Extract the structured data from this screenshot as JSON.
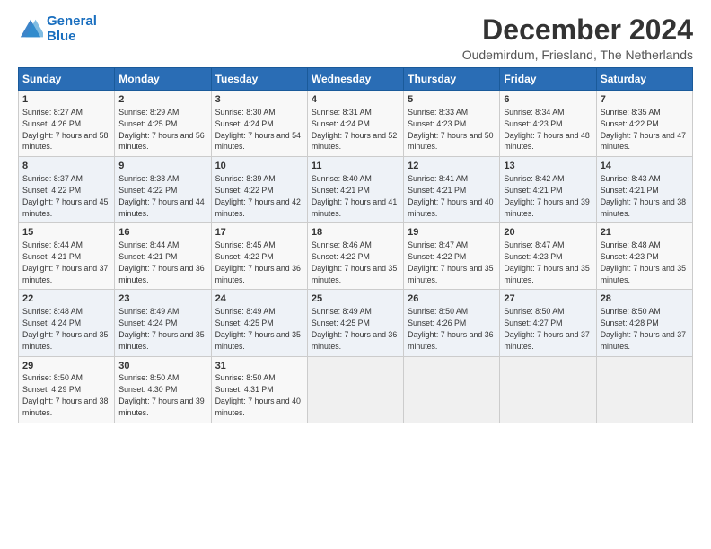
{
  "logo": {
    "line1": "General",
    "line2": "Blue"
  },
  "title": "December 2024",
  "subtitle": "Oudemirdum, Friesland, The Netherlands",
  "days_of_week": [
    "Sunday",
    "Monday",
    "Tuesday",
    "Wednesday",
    "Thursday",
    "Friday",
    "Saturday"
  ],
  "weeks": [
    [
      {
        "day": "1",
        "sunrise": "8:27 AM",
        "sunset": "4:26 PM",
        "daylight": "7 hours and 58 minutes."
      },
      {
        "day": "2",
        "sunrise": "8:29 AM",
        "sunset": "4:25 PM",
        "daylight": "7 hours and 56 minutes."
      },
      {
        "day": "3",
        "sunrise": "8:30 AM",
        "sunset": "4:24 PM",
        "daylight": "7 hours and 54 minutes."
      },
      {
        "day": "4",
        "sunrise": "8:31 AM",
        "sunset": "4:24 PM",
        "daylight": "7 hours and 52 minutes."
      },
      {
        "day": "5",
        "sunrise": "8:33 AM",
        "sunset": "4:23 PM",
        "daylight": "7 hours and 50 minutes."
      },
      {
        "day": "6",
        "sunrise": "8:34 AM",
        "sunset": "4:23 PM",
        "daylight": "7 hours and 48 minutes."
      },
      {
        "day": "7",
        "sunrise": "8:35 AM",
        "sunset": "4:22 PM",
        "daylight": "7 hours and 47 minutes."
      }
    ],
    [
      {
        "day": "8",
        "sunrise": "8:37 AM",
        "sunset": "4:22 PM",
        "daylight": "7 hours and 45 minutes."
      },
      {
        "day": "9",
        "sunrise": "8:38 AM",
        "sunset": "4:22 PM",
        "daylight": "7 hours and 44 minutes."
      },
      {
        "day": "10",
        "sunrise": "8:39 AM",
        "sunset": "4:22 PM",
        "daylight": "7 hours and 42 minutes."
      },
      {
        "day": "11",
        "sunrise": "8:40 AM",
        "sunset": "4:21 PM",
        "daylight": "7 hours and 41 minutes."
      },
      {
        "day": "12",
        "sunrise": "8:41 AM",
        "sunset": "4:21 PM",
        "daylight": "7 hours and 40 minutes."
      },
      {
        "day": "13",
        "sunrise": "8:42 AM",
        "sunset": "4:21 PM",
        "daylight": "7 hours and 39 minutes."
      },
      {
        "day": "14",
        "sunrise": "8:43 AM",
        "sunset": "4:21 PM",
        "daylight": "7 hours and 38 minutes."
      }
    ],
    [
      {
        "day": "15",
        "sunrise": "8:44 AM",
        "sunset": "4:21 PM",
        "daylight": "7 hours and 37 minutes."
      },
      {
        "day": "16",
        "sunrise": "8:44 AM",
        "sunset": "4:21 PM",
        "daylight": "7 hours and 36 minutes."
      },
      {
        "day": "17",
        "sunrise": "8:45 AM",
        "sunset": "4:22 PM",
        "daylight": "7 hours and 36 minutes."
      },
      {
        "day": "18",
        "sunrise": "8:46 AM",
        "sunset": "4:22 PM",
        "daylight": "7 hours and 35 minutes."
      },
      {
        "day": "19",
        "sunrise": "8:47 AM",
        "sunset": "4:22 PM",
        "daylight": "7 hours and 35 minutes."
      },
      {
        "day": "20",
        "sunrise": "8:47 AM",
        "sunset": "4:23 PM",
        "daylight": "7 hours and 35 minutes."
      },
      {
        "day": "21",
        "sunrise": "8:48 AM",
        "sunset": "4:23 PM",
        "daylight": "7 hours and 35 minutes."
      }
    ],
    [
      {
        "day": "22",
        "sunrise": "8:48 AM",
        "sunset": "4:24 PM",
        "daylight": "7 hours and 35 minutes."
      },
      {
        "day": "23",
        "sunrise": "8:49 AM",
        "sunset": "4:24 PM",
        "daylight": "7 hours and 35 minutes."
      },
      {
        "day": "24",
        "sunrise": "8:49 AM",
        "sunset": "4:25 PM",
        "daylight": "7 hours and 35 minutes."
      },
      {
        "day": "25",
        "sunrise": "8:49 AM",
        "sunset": "4:25 PM",
        "daylight": "7 hours and 36 minutes."
      },
      {
        "day": "26",
        "sunrise": "8:50 AM",
        "sunset": "4:26 PM",
        "daylight": "7 hours and 36 minutes."
      },
      {
        "day": "27",
        "sunrise": "8:50 AM",
        "sunset": "4:27 PM",
        "daylight": "7 hours and 37 minutes."
      },
      {
        "day": "28",
        "sunrise": "8:50 AM",
        "sunset": "4:28 PM",
        "daylight": "7 hours and 37 minutes."
      }
    ],
    [
      {
        "day": "29",
        "sunrise": "8:50 AM",
        "sunset": "4:29 PM",
        "daylight": "7 hours and 38 minutes."
      },
      {
        "day": "30",
        "sunrise": "8:50 AM",
        "sunset": "4:30 PM",
        "daylight": "7 hours and 39 minutes."
      },
      {
        "day": "31",
        "sunrise": "8:50 AM",
        "sunset": "4:31 PM",
        "daylight": "7 hours and 40 minutes."
      },
      null,
      null,
      null,
      null
    ]
  ]
}
